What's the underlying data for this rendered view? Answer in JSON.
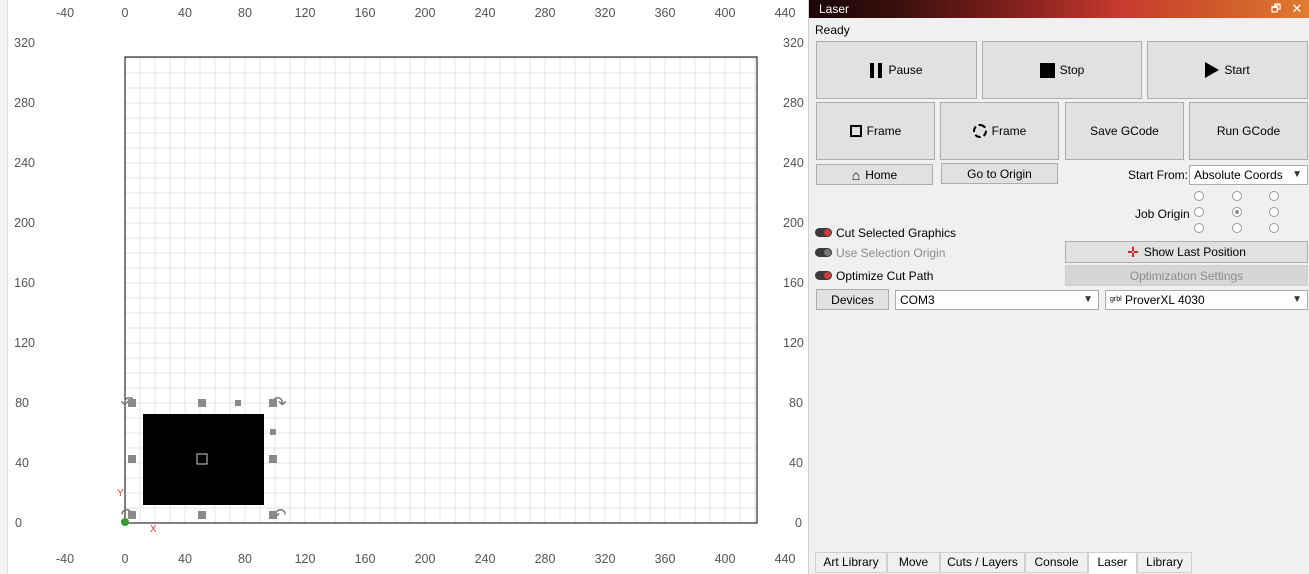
{
  "canvas": {
    "x_ticks": [
      "-40",
      "0",
      "40",
      "80",
      "120",
      "160",
      "200",
      "240",
      "280",
      "320",
      "360",
      "400",
      "440"
    ],
    "y_ticks": [
      "320",
      "280",
      "240",
      "200",
      "160",
      "120",
      "80",
      "40",
      "0"
    ],
    "axis_x_letter": "X",
    "axis_y_letter": "Y"
  },
  "panel": {
    "title": "Laser",
    "float_icon": "restore-window-icon",
    "close_icon": "close-icon",
    "status": "Ready",
    "buttons": {
      "pause": "Pause",
      "stop": "Stop",
      "start": "Start",
      "frame_rect": "Frame",
      "frame_circle": "Frame",
      "save_gcode": "Save GCode",
      "run_gcode": "Run GCode",
      "home": "Home",
      "go_to_origin": "Go to Origin",
      "show_last_position": "Show Last Position",
      "optimization_settings": "Optimization Settings",
      "devices": "Devices"
    },
    "start_from_label": "Start From:",
    "start_from_value": "Absolute Coords",
    "job_origin_label": "Job Origin",
    "job_origin_selected": "center",
    "options": {
      "cut_selected": "Cut Selected Graphics",
      "use_selection_origin": "Use Selection Origin",
      "optimize_cut_path": "Optimize Cut Path"
    },
    "port_value": "COM3",
    "device_prefix": "grbl",
    "device_value": "ProverXL 4030",
    "tabs": [
      "Art Library",
      "Move",
      "Cuts / Layers",
      "Console",
      "Laser",
      "Library"
    ],
    "active_tab": "Laser"
  }
}
